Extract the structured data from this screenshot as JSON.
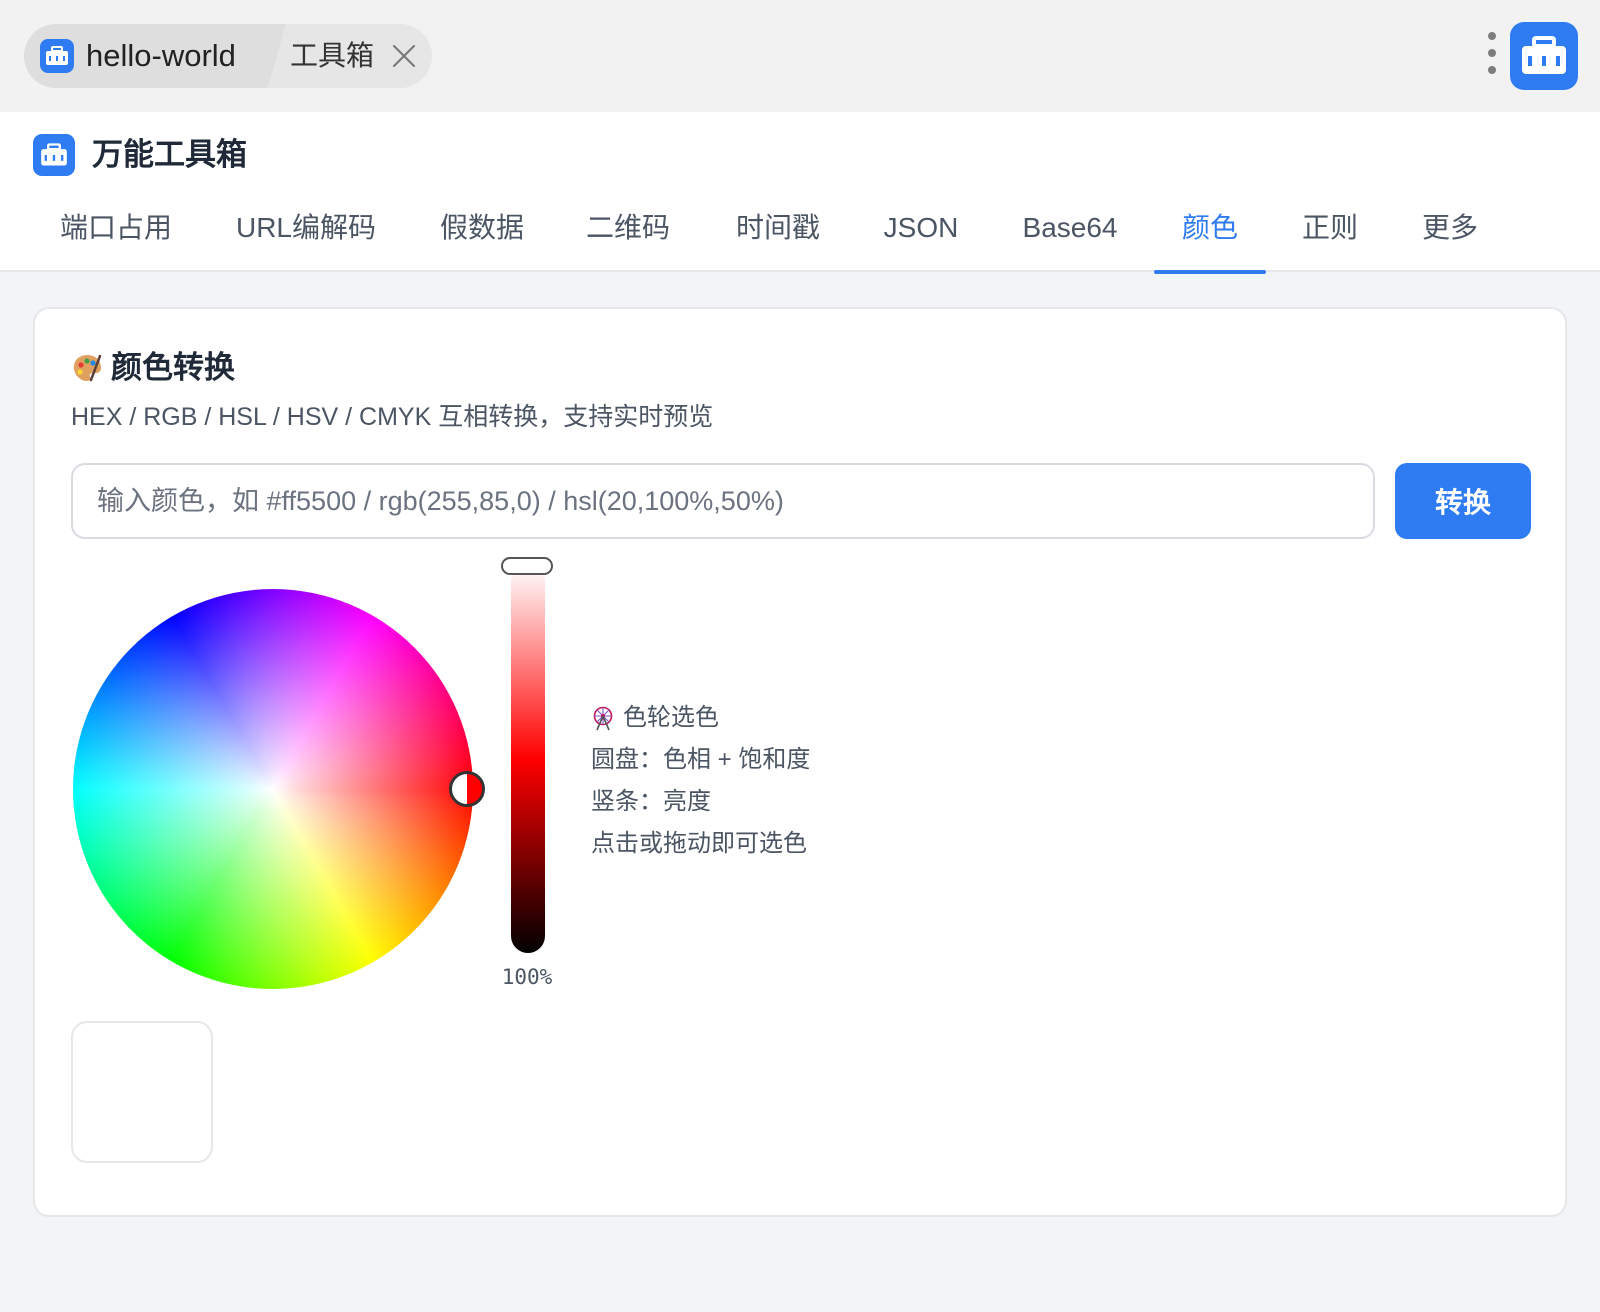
{
  "titlebar": {
    "project_name": "hello-world",
    "tab_label": "工具箱",
    "icons": [
      "toolbox-icon",
      "close-icon",
      "more-vertical-icon"
    ]
  },
  "header": {
    "app_title": "万能工具箱",
    "tabs": [
      {
        "label": "端口占用"
      },
      {
        "label": "URL编解码"
      },
      {
        "label": "假数据"
      },
      {
        "label": "二维码"
      },
      {
        "label": "时间戳"
      },
      {
        "label": "JSON"
      },
      {
        "label": "Base64"
      },
      {
        "label": "颜色",
        "active": true
      },
      {
        "label": "正则"
      },
      {
        "label": "更多"
      }
    ]
  },
  "card": {
    "title": "颜色转换",
    "title_icon": "palette-icon",
    "subtitle": "HEX / RGB / HSL / HSV / CMYK 互相转换，支持实时预览",
    "input": {
      "value": "",
      "placeholder": "输入颜色，如 #ff5500 / rgb(255,85,0) / hsl(20,100%,50%)"
    },
    "convert_label": "转换",
    "brightness_percent": 100,
    "brightness_label": "100%",
    "info": {
      "heading": "色轮选色",
      "heading_icon": "ferris-wheel-icon",
      "lines": [
        "圆盘：色相 + 饱和度",
        "竖条：亮度",
        "点击或拖动即可选色"
      ]
    },
    "preview_color": "#ffffff"
  },
  "colors": {
    "accent": "#2f7bf2",
    "titlebar_bg": "#f2f2f2",
    "page_bg": "#f3f4f6"
  }
}
